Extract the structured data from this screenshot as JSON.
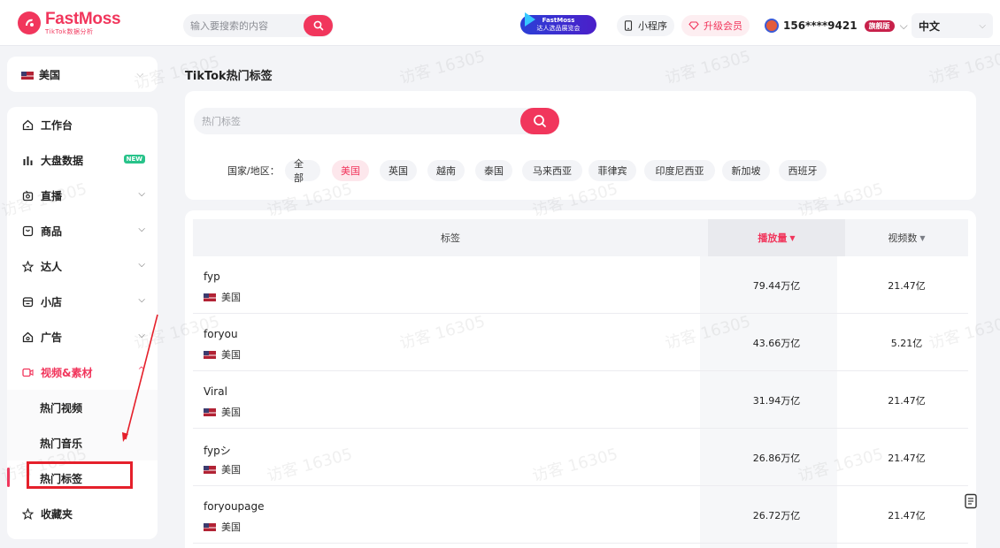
{
  "header": {
    "logo_title": "FastMoss",
    "logo_sub": "TikTok数据分析",
    "search_placeholder": "输入要搜索的内容",
    "promo_line1": "FastMoss",
    "promo_line2": "达人选品展览会",
    "mini_program": "小程序",
    "upgrade": "升级会员",
    "user_phone": "156****9421",
    "user_badge": "旗舰版",
    "language": "中文"
  },
  "sidebar": {
    "region": "美国",
    "items": [
      {
        "label": "工作台",
        "icon": "home-icon"
      },
      {
        "label": "大盘数据",
        "icon": "bar-chart-icon",
        "badge": "NEW"
      },
      {
        "label": "直播",
        "icon": "live-icon"
      },
      {
        "label": "商品",
        "icon": "product-icon"
      },
      {
        "label": "达人",
        "icon": "star-icon"
      },
      {
        "label": "小店",
        "icon": "shop-icon"
      },
      {
        "label": "广告",
        "icon": "ad-icon"
      },
      {
        "label": "视频&素材",
        "icon": "video-icon"
      }
    ],
    "sub_items": [
      "热门视频",
      "热门音乐",
      "热门标签"
    ],
    "favorites": "收藏夹"
  },
  "main": {
    "title": "TikTok热门标签",
    "tag_search_placeholder": "热门标签",
    "region_label": "国家/地区：",
    "regions": [
      "全部",
      "美国",
      "英国",
      "越南",
      "泰国",
      "马来西亚",
      "菲律宾",
      "印度尼西亚",
      "新加坡",
      "西班牙"
    ],
    "selected_region": "美国"
  },
  "table": {
    "headers": {
      "tag": "标签",
      "plays": "播放量",
      "videos": "视频数"
    },
    "rows": [
      {
        "tag": "fyp",
        "region": "美国",
        "plays": "79.44万亿",
        "videos": "21.47亿"
      },
      {
        "tag": "foryou",
        "region": "美国",
        "plays": "43.66万亿",
        "videos": "5.21亿"
      },
      {
        "tag": "Viral",
        "region": "美国",
        "plays": "31.94万亿",
        "videos": "21.47亿"
      },
      {
        "tag": "fypシ",
        "region": "美国",
        "plays": "26.86万亿",
        "videos": "21.47亿"
      },
      {
        "tag": "foryoupage",
        "region": "美国",
        "plays": "26.72万亿",
        "videos": "21.47亿"
      }
    ]
  },
  "watermark": "访客 16305",
  "colors": {
    "brand": "#f1365c",
    "annotation": "#e5202b"
  }
}
